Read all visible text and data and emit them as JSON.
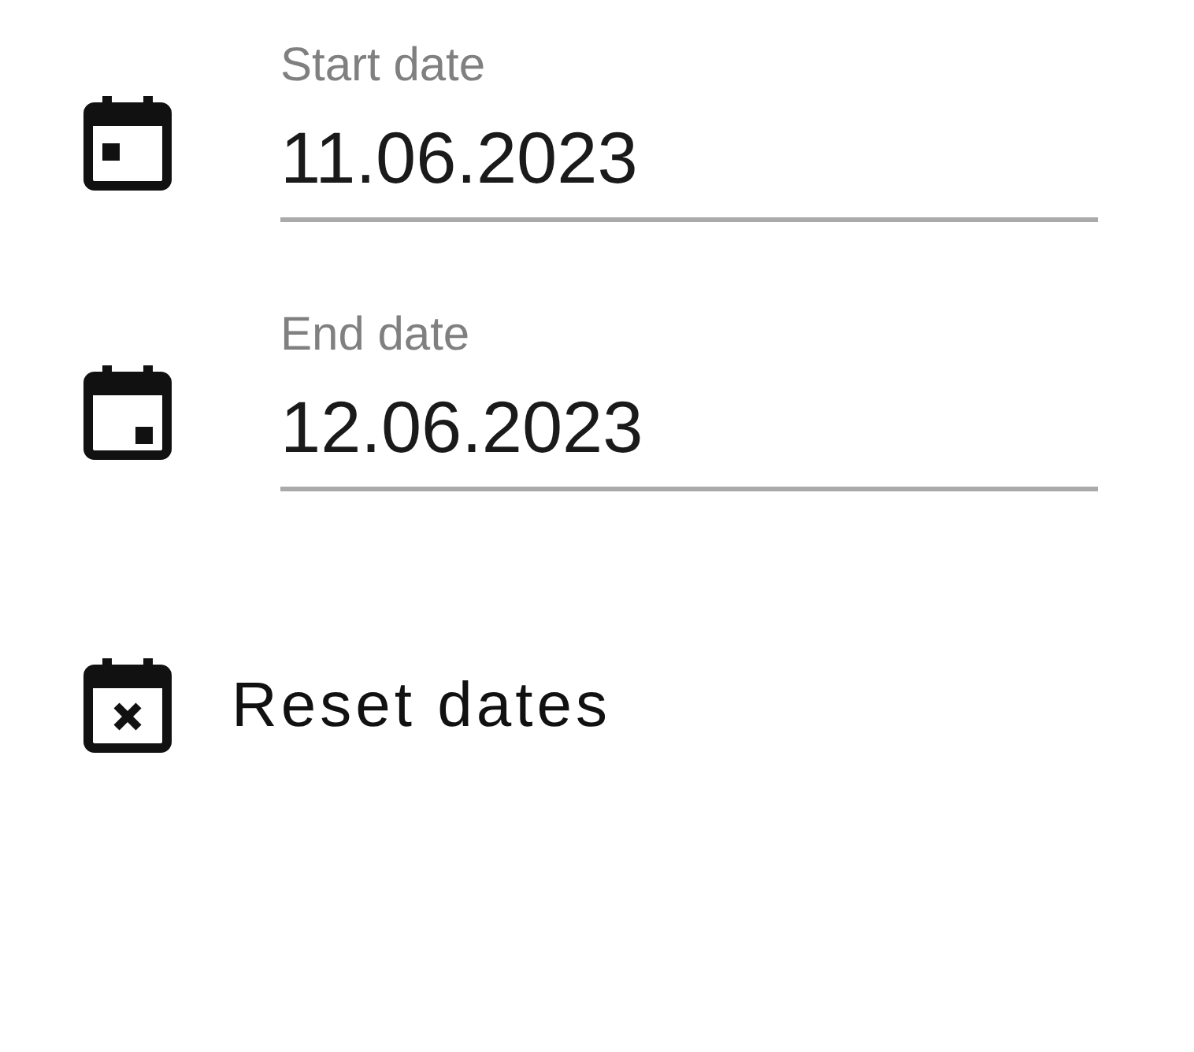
{
  "fields": [
    {
      "kind": "start",
      "label": "Start date",
      "value": "11.06.2023"
    },
    {
      "kind": "end",
      "label": "End date",
      "value": "12.06.2023"
    }
  ],
  "reset_button": {
    "label": "Reset dates"
  }
}
